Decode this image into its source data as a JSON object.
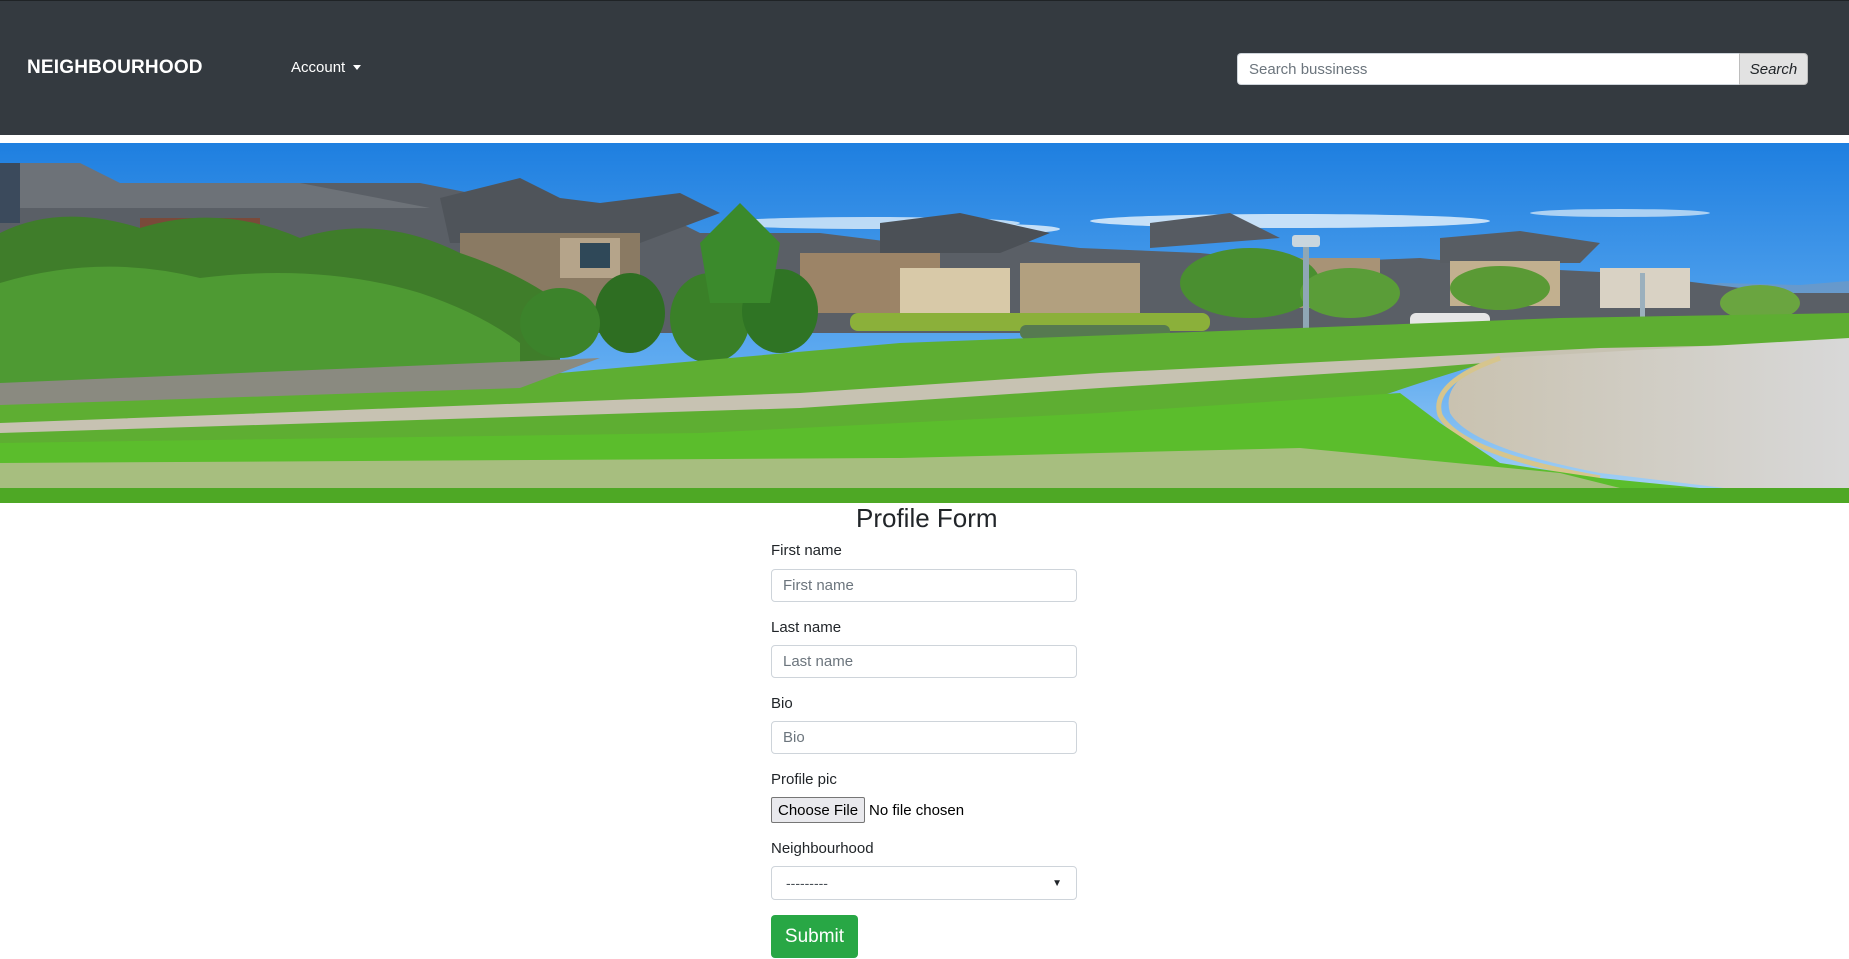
{
  "navbar": {
    "brand": "NEIGHBOURHOOD",
    "account_label": "Account",
    "search_placeholder": "Search bussiness",
    "search_button": "Search",
    "background_color": "#343a40"
  },
  "hero": {
    "description_icon": "neighbourhood-street-banner"
  },
  "form": {
    "title": "Profile Form",
    "first_name": {
      "label": "First name",
      "placeholder": "First name"
    },
    "last_name": {
      "label": "Last name",
      "placeholder": "Last name"
    },
    "bio": {
      "label": "Bio",
      "placeholder": "Bio"
    },
    "profile_pic": {
      "label": "Profile pic",
      "button": "Choose File",
      "status": "No file chosen"
    },
    "neighbourhood": {
      "label": "Neighbourhood",
      "selected": "---------"
    },
    "submit_label": "Submit",
    "submit_color": "#28a745"
  }
}
